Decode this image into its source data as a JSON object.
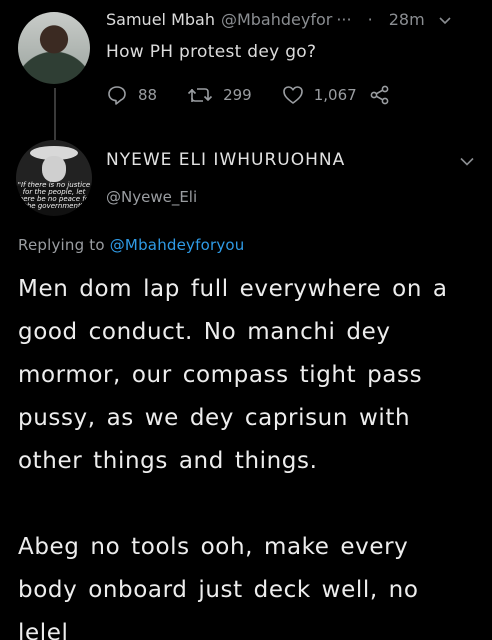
{
  "parent_tweet": {
    "author_name": "Samuel Mbah",
    "handle": "@Mbahdeyfor",
    "more": "···",
    "separator": "·",
    "time": "28m",
    "text": "How PH protest dey go?",
    "replies": "88",
    "retweets": "299",
    "likes": "1,067"
  },
  "reply_tweet": {
    "author_name": "NYEWE ELI IWHURUOHNA",
    "handle": "@Nyewe_Eli",
    "avatar_caption": "\"If there is no justice for the people, let there be no peace for the government\"",
    "replying_prefix": "Replying to",
    "replying_to": "@Mbahdeyforyou",
    "paragraphs": [
      "Men dom lap full everywhere on a good conduct. No manchi dey mormor, our compass tight pass pussy, as we dey caprisun with other things and things.",
      "Abeg no tools ooh, make every body onboard just deck well, no lelel"
    ]
  },
  "colors": {
    "background": "#000000",
    "text_primary": "#ededed",
    "text_secondary": "#9a9da1",
    "link": "#2f9be6"
  }
}
